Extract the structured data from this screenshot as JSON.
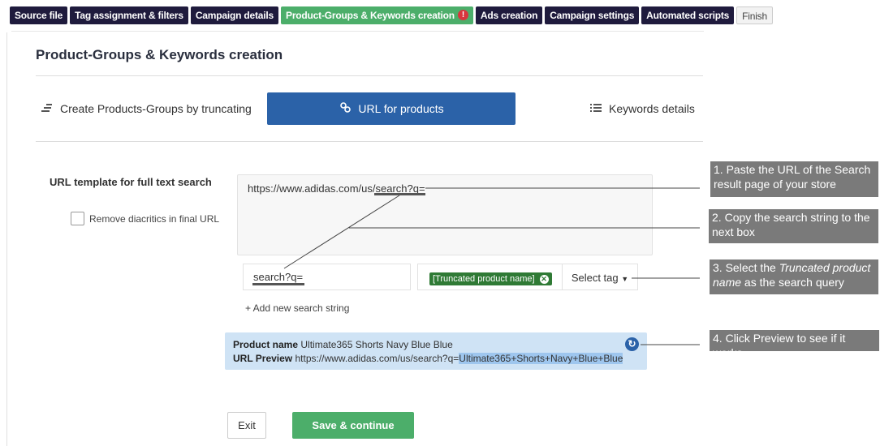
{
  "steps": [
    {
      "label": "Source file"
    },
    {
      "label": "Tag assignment & filters"
    },
    {
      "label": "Campaign details"
    },
    {
      "label": "Product-Groups & Keywords creation",
      "alert": "!"
    },
    {
      "label": "Ads creation"
    },
    {
      "label": "Campaign settings"
    },
    {
      "label": "Automated scripts"
    },
    {
      "label": "Finish"
    }
  ],
  "page_title": "Product-Groups & Keywords creation",
  "subtabs": {
    "truncate": "Create Products-Groups by truncating",
    "url": "URL for products",
    "keywords": "Keywords details"
  },
  "form": {
    "template_label": "URL template for full text search",
    "remove_diacritics": "Remove diacritics in final URL",
    "url_template": "https://www.adidas.com/us/search?q=",
    "search_string": "search?q=",
    "tag_chip": "[Truncated product name]",
    "select_tag": "Select tag",
    "add_search": "+ Add new search string"
  },
  "preview": {
    "name_label": "Product name",
    "name_value": "Ultimate365 Shorts Navy Blue Blue",
    "url_label": "URL Preview",
    "url_base": "https://www.adidas.com/us/search?q=",
    "url_query": "Ultimate365+Shorts+Navy+Blue+Blue"
  },
  "buttons": {
    "exit": "Exit",
    "save": "Save & continue"
  },
  "callouts": {
    "c1_num": "1.",
    "c1_text": "Paste the URL of the Search result page of your store",
    "c2_num": "2.",
    "c2_text": "Copy the search string to the next box",
    "c3_num": "3.",
    "c3_pre": "Select the",
    "c3_em": "Truncated product name",
    "c3_post": "as the search query",
    "c4_num": "4.",
    "c4_text": "Click Preview to see if it works"
  },
  "colors": {
    "nav_dark": "#1f1b3d",
    "active_green": "#4cae6a",
    "primary_blue": "#2b62a8",
    "preview_bg": "#cfe3f5",
    "callout_gray": "#7a7a7a",
    "chip_green": "#2f7a35"
  },
  "icons": {
    "truncate": "bars-descending-icon",
    "url": "link-icon",
    "keywords": "list-icon",
    "alert": "exclamation-icon",
    "refresh": "refresh-icon",
    "caret": "caret-down-icon",
    "chip_remove": "close-circle-icon"
  }
}
